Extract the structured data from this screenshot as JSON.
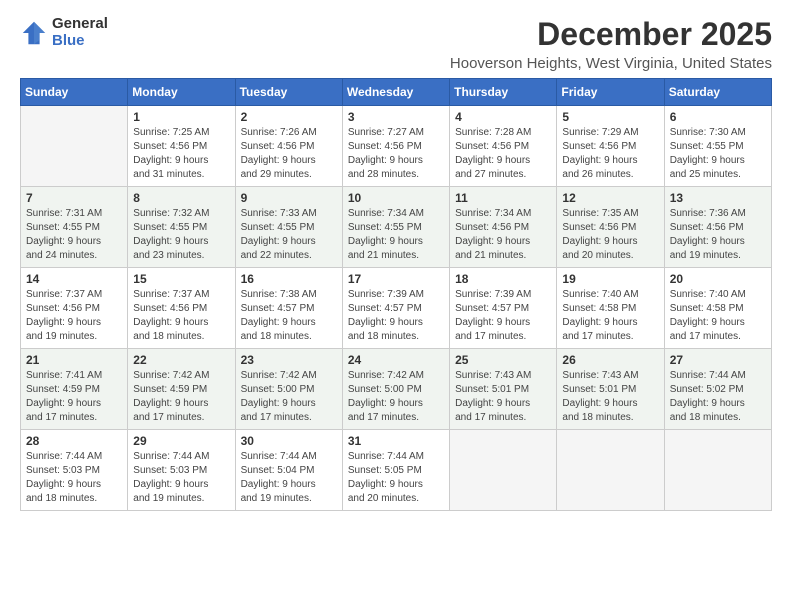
{
  "logo": {
    "general": "General",
    "blue": "Blue"
  },
  "title": "December 2025",
  "location": "Hooverson Heights, West Virginia, United States",
  "days_of_week": [
    "Sunday",
    "Monday",
    "Tuesday",
    "Wednesday",
    "Thursday",
    "Friday",
    "Saturday"
  ],
  "weeks": [
    [
      {
        "day": "",
        "info": ""
      },
      {
        "day": "1",
        "info": "Sunrise: 7:25 AM\nSunset: 4:56 PM\nDaylight: 9 hours\nand 31 minutes."
      },
      {
        "day": "2",
        "info": "Sunrise: 7:26 AM\nSunset: 4:56 PM\nDaylight: 9 hours\nand 29 minutes."
      },
      {
        "day": "3",
        "info": "Sunrise: 7:27 AM\nSunset: 4:56 PM\nDaylight: 9 hours\nand 28 minutes."
      },
      {
        "day": "4",
        "info": "Sunrise: 7:28 AM\nSunset: 4:56 PM\nDaylight: 9 hours\nand 27 minutes."
      },
      {
        "day": "5",
        "info": "Sunrise: 7:29 AM\nSunset: 4:56 PM\nDaylight: 9 hours\nand 26 minutes."
      },
      {
        "day": "6",
        "info": "Sunrise: 7:30 AM\nSunset: 4:55 PM\nDaylight: 9 hours\nand 25 minutes."
      }
    ],
    [
      {
        "day": "7",
        "info": "Sunrise: 7:31 AM\nSunset: 4:55 PM\nDaylight: 9 hours\nand 24 minutes."
      },
      {
        "day": "8",
        "info": "Sunrise: 7:32 AM\nSunset: 4:55 PM\nDaylight: 9 hours\nand 23 minutes."
      },
      {
        "day": "9",
        "info": "Sunrise: 7:33 AM\nSunset: 4:55 PM\nDaylight: 9 hours\nand 22 minutes."
      },
      {
        "day": "10",
        "info": "Sunrise: 7:34 AM\nSunset: 4:55 PM\nDaylight: 9 hours\nand 21 minutes."
      },
      {
        "day": "11",
        "info": "Sunrise: 7:34 AM\nSunset: 4:56 PM\nDaylight: 9 hours\nand 21 minutes."
      },
      {
        "day": "12",
        "info": "Sunrise: 7:35 AM\nSunset: 4:56 PM\nDaylight: 9 hours\nand 20 minutes."
      },
      {
        "day": "13",
        "info": "Sunrise: 7:36 AM\nSunset: 4:56 PM\nDaylight: 9 hours\nand 19 minutes."
      }
    ],
    [
      {
        "day": "14",
        "info": "Sunrise: 7:37 AM\nSunset: 4:56 PM\nDaylight: 9 hours\nand 19 minutes."
      },
      {
        "day": "15",
        "info": "Sunrise: 7:37 AM\nSunset: 4:56 PM\nDaylight: 9 hours\nand 18 minutes."
      },
      {
        "day": "16",
        "info": "Sunrise: 7:38 AM\nSunset: 4:57 PM\nDaylight: 9 hours\nand 18 minutes."
      },
      {
        "day": "17",
        "info": "Sunrise: 7:39 AM\nSunset: 4:57 PM\nDaylight: 9 hours\nand 18 minutes."
      },
      {
        "day": "18",
        "info": "Sunrise: 7:39 AM\nSunset: 4:57 PM\nDaylight: 9 hours\nand 17 minutes."
      },
      {
        "day": "19",
        "info": "Sunrise: 7:40 AM\nSunset: 4:58 PM\nDaylight: 9 hours\nand 17 minutes."
      },
      {
        "day": "20",
        "info": "Sunrise: 7:40 AM\nSunset: 4:58 PM\nDaylight: 9 hours\nand 17 minutes."
      }
    ],
    [
      {
        "day": "21",
        "info": "Sunrise: 7:41 AM\nSunset: 4:59 PM\nDaylight: 9 hours\nand 17 minutes."
      },
      {
        "day": "22",
        "info": "Sunrise: 7:42 AM\nSunset: 4:59 PM\nDaylight: 9 hours\nand 17 minutes."
      },
      {
        "day": "23",
        "info": "Sunrise: 7:42 AM\nSunset: 5:00 PM\nDaylight: 9 hours\nand 17 minutes."
      },
      {
        "day": "24",
        "info": "Sunrise: 7:42 AM\nSunset: 5:00 PM\nDaylight: 9 hours\nand 17 minutes."
      },
      {
        "day": "25",
        "info": "Sunrise: 7:43 AM\nSunset: 5:01 PM\nDaylight: 9 hours\nand 17 minutes."
      },
      {
        "day": "26",
        "info": "Sunrise: 7:43 AM\nSunset: 5:01 PM\nDaylight: 9 hours\nand 18 minutes."
      },
      {
        "day": "27",
        "info": "Sunrise: 7:44 AM\nSunset: 5:02 PM\nDaylight: 9 hours\nand 18 minutes."
      }
    ],
    [
      {
        "day": "28",
        "info": "Sunrise: 7:44 AM\nSunset: 5:03 PM\nDaylight: 9 hours\nand 18 minutes."
      },
      {
        "day": "29",
        "info": "Sunrise: 7:44 AM\nSunset: 5:03 PM\nDaylight: 9 hours\nand 19 minutes."
      },
      {
        "day": "30",
        "info": "Sunrise: 7:44 AM\nSunset: 5:04 PM\nDaylight: 9 hours\nand 19 minutes."
      },
      {
        "day": "31",
        "info": "Sunrise: 7:44 AM\nSunset: 5:05 PM\nDaylight: 9 hours\nand 20 minutes."
      },
      {
        "day": "",
        "info": ""
      },
      {
        "day": "",
        "info": ""
      },
      {
        "day": "",
        "info": ""
      }
    ]
  ]
}
